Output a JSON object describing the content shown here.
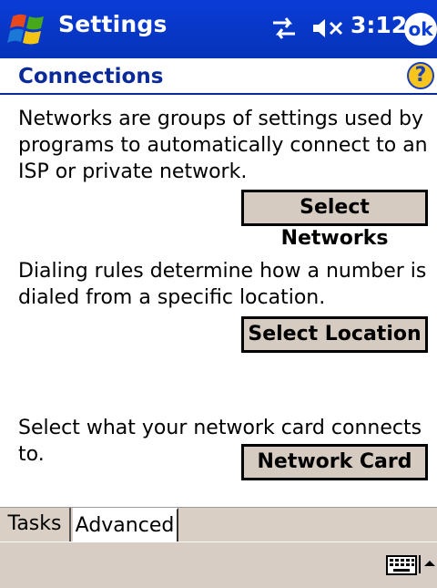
{
  "titlebar": {
    "title": "Settings",
    "time": "3:12",
    "ok_label": "ok",
    "icons": [
      "windows-flag-icon",
      "connectivity-icon",
      "speaker-muted-icon"
    ]
  },
  "header": {
    "title": "Connections",
    "help_label": "?"
  },
  "sections": {
    "networks_desc": "Networks are groups of settings used by programs to automatically connect to an ISP or private network.",
    "networks_button": "Select Networks",
    "dialing_desc": "Dialing rules determine how a number is dialed from a specific location.",
    "dialing_button": "Select Location",
    "card_desc": "Select what your network card connects to.",
    "card_button": "Network Card"
  },
  "tabs": [
    {
      "label": "Tasks",
      "selected": false
    },
    {
      "label": "Advanced",
      "selected": true
    }
  ],
  "bottombar": {
    "icons": [
      "keyboard-icon",
      "arrow-up-icon"
    ]
  },
  "colors": {
    "titlebar": "#0a3cd6",
    "accent": "#0a2a9c",
    "button_face": "#d6cbc0",
    "bar": "#d8cdc4"
  }
}
